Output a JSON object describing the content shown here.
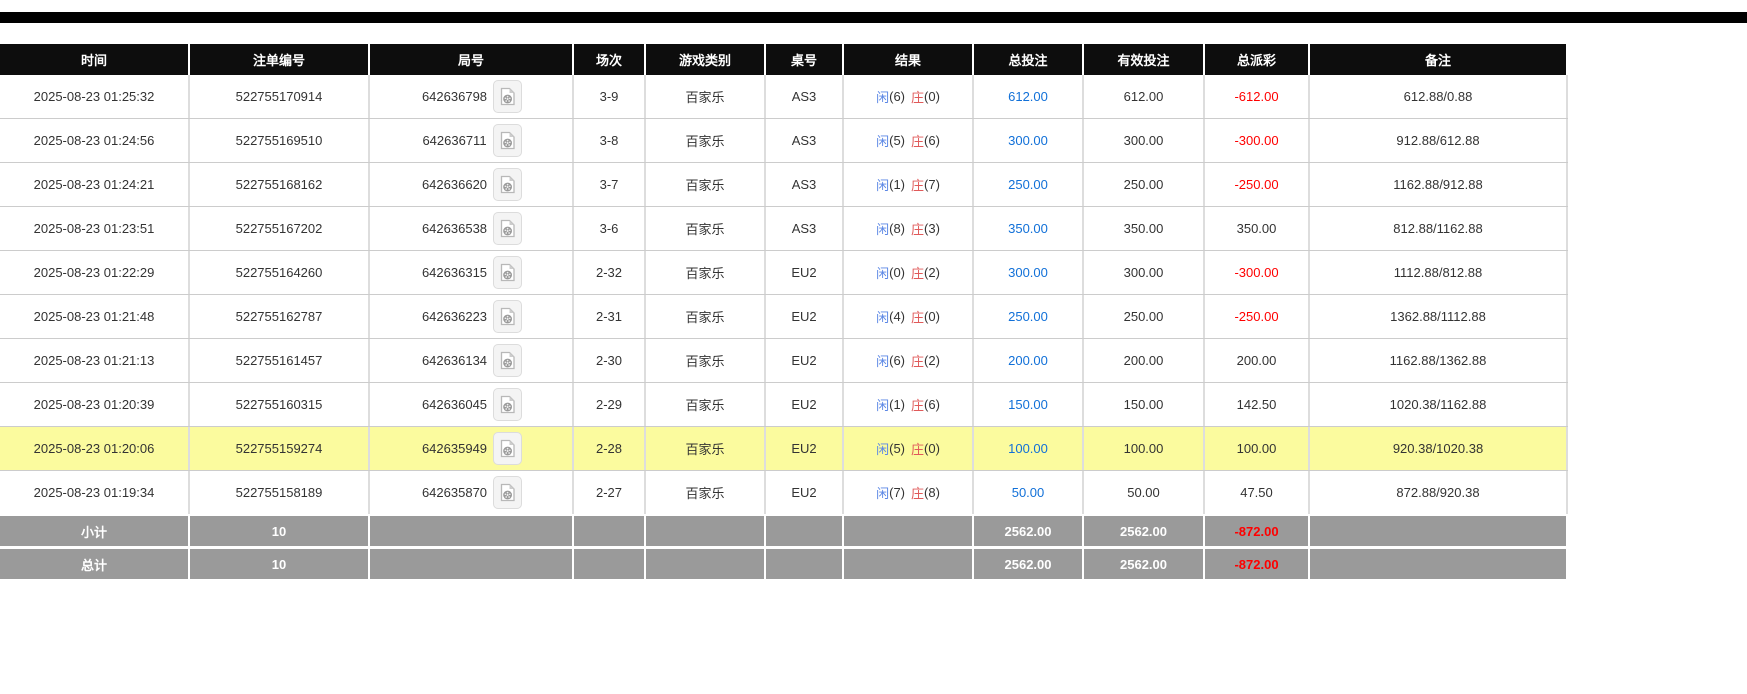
{
  "top_bar": {
    "color": "#000000"
  },
  "table": {
    "columns": {
      "time": "时间",
      "bet_id": "注单编号",
      "round_id": "局号",
      "session": "场次",
      "game_type": "游戏类别",
      "table_no": "桌号",
      "result": "结果",
      "total_bet": "总投注",
      "valid_bet": "有效投注",
      "payout": "总派彩",
      "remark": "备注"
    },
    "rows": [
      {
        "time": "2025-08-23 01:25:32",
        "bet_id": "522755170914",
        "round_id": "642636798",
        "session": "3-9",
        "game": "百家乐",
        "table": "AS3",
        "player": "闲",
        "player_pts": "(6)",
        "banker": "庄",
        "banker_pts": "(0)",
        "total_bet": "612.00",
        "valid_bet": "612.00",
        "payout": "-612.00",
        "remark": "612.88/0.88",
        "highlight": false
      },
      {
        "time": "2025-08-23 01:24:56",
        "bet_id": "522755169510",
        "round_id": "642636711",
        "session": "3-8",
        "game": "百家乐",
        "table": "AS3",
        "player": "闲",
        "player_pts": "(5)",
        "banker": "庄",
        "banker_pts": "(6)",
        "total_bet": "300.00",
        "valid_bet": "300.00",
        "payout": "-300.00",
        "remark": "912.88/612.88",
        "highlight": false
      },
      {
        "time": "2025-08-23 01:24:21",
        "bet_id": "522755168162",
        "round_id": "642636620",
        "session": "3-7",
        "game": "百家乐",
        "table": "AS3",
        "player": "闲",
        "player_pts": "(1)",
        "banker": "庄",
        "banker_pts": "(7)",
        "total_bet": "250.00",
        "valid_bet": "250.00",
        "payout": "-250.00",
        "remark": "1162.88/912.88",
        "highlight": false
      },
      {
        "time": "2025-08-23 01:23:51",
        "bet_id": "522755167202",
        "round_id": "642636538",
        "session": "3-6",
        "game": "百家乐",
        "table": "AS3",
        "player": "闲",
        "player_pts": "(8)",
        "banker": "庄",
        "banker_pts": "(3)",
        "total_bet": "350.00",
        "valid_bet": "350.00",
        "payout": "350.00",
        "remark": "812.88/1162.88",
        "highlight": false
      },
      {
        "time": "2025-08-23 01:22:29",
        "bet_id": "522755164260",
        "round_id": "642636315",
        "session": "2-32",
        "game": "百家乐",
        "table": "EU2",
        "player": "闲",
        "player_pts": "(0)",
        "banker": "庄",
        "banker_pts": "(2)",
        "total_bet": "300.00",
        "valid_bet": "300.00",
        "payout": "-300.00",
        "remark": "1112.88/812.88",
        "highlight": false
      },
      {
        "time": "2025-08-23 01:21:48",
        "bet_id": "522755162787",
        "round_id": "642636223",
        "session": "2-31",
        "game": "百家乐",
        "table": "EU2",
        "player": "闲",
        "player_pts": "(4)",
        "banker": "庄",
        "banker_pts": "(0)",
        "total_bet": "250.00",
        "valid_bet": "250.00",
        "payout": "-250.00",
        "remark": "1362.88/1112.88",
        "highlight": false
      },
      {
        "time": "2025-08-23 01:21:13",
        "bet_id": "522755161457",
        "round_id": "642636134",
        "session": "2-30",
        "game": "百家乐",
        "table": "EU2",
        "player": "闲",
        "player_pts": "(6)",
        "banker": "庄",
        "banker_pts": "(2)",
        "total_bet": "200.00",
        "valid_bet": "200.00",
        "payout": "200.00",
        "remark": "1162.88/1362.88",
        "highlight": false
      },
      {
        "time": "2025-08-23 01:20:39",
        "bet_id": "522755160315",
        "round_id": "642636045",
        "session": "2-29",
        "game": "百家乐",
        "table": "EU2",
        "player": "闲",
        "player_pts": "(1)",
        "banker": "庄",
        "banker_pts": "(6)",
        "total_bet": "150.00",
        "valid_bet": "150.00",
        "payout": "142.50",
        "remark": "1020.38/1162.88",
        "highlight": false
      },
      {
        "time": "2025-08-23 01:20:06",
        "bet_id": "522755159274",
        "round_id": "642635949",
        "session": "2-28",
        "game": "百家乐",
        "table": "EU2",
        "player": "闲",
        "player_pts": "(5)",
        "banker": "庄",
        "banker_pts": "(0)",
        "total_bet": "100.00",
        "valid_bet": "100.00",
        "payout": "100.00",
        "remark": "920.38/1020.38",
        "highlight": true
      },
      {
        "time": "2025-08-23 01:19:34",
        "bet_id": "522755158189",
        "round_id": "642635870",
        "session": "2-27",
        "game": "百家乐",
        "table": "EU2",
        "player": "闲",
        "player_pts": "(7)",
        "banker": "庄",
        "banker_pts": "(8)",
        "total_bet": "50.00",
        "valid_bet": "50.00",
        "payout": "47.50",
        "remark": "872.88/920.38",
        "highlight": false
      }
    ],
    "summary": [
      {
        "label": "小计",
        "count": "10",
        "total_bet": "2562.00",
        "valid_bet": "2562.00",
        "payout": "-872.00"
      },
      {
        "label": "总计",
        "count": "10",
        "total_bet": "2562.00",
        "valid_bet": "2562.00",
        "payout": "-872.00"
      }
    ]
  },
  "icons": {
    "round_replay": "video-replay-icon"
  },
  "colors": {
    "header_bg": "#0d0d0d",
    "accent_blue": "#1170d8",
    "player_blue": "#5b87e5",
    "banker_red": "#e05a5a",
    "negative_red": "#ff0000",
    "highlight_yellow": "#fbfb9e",
    "summary_gray": "#9a9a9a"
  }
}
